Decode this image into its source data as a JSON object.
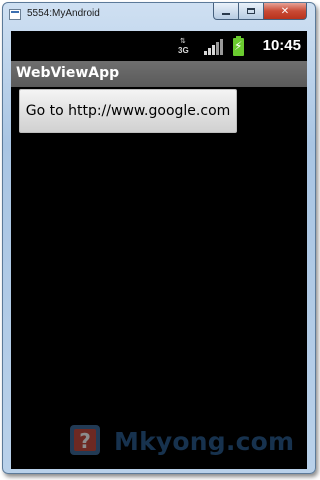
{
  "window": {
    "title": "5554:MyAndroid",
    "icon": "emulator-window-icon"
  },
  "status_bar": {
    "network_label": "3G",
    "network_arrows": "⇅",
    "time": "10:45",
    "signal_level": 0.5,
    "battery_level": 1.0,
    "battery_charging": true
  },
  "app_bar": {
    "title": "WebViewApp"
  },
  "main": {
    "go_button_label": "Go to http://www.google.com"
  },
  "watermark": {
    "text": "Mkyong.com"
  },
  "colors": {
    "screen_background": "#000000",
    "app_bar": "#606060",
    "battery": "#6acb2f",
    "close_button": "#c94a35",
    "watermark": "#2a5c8f"
  }
}
